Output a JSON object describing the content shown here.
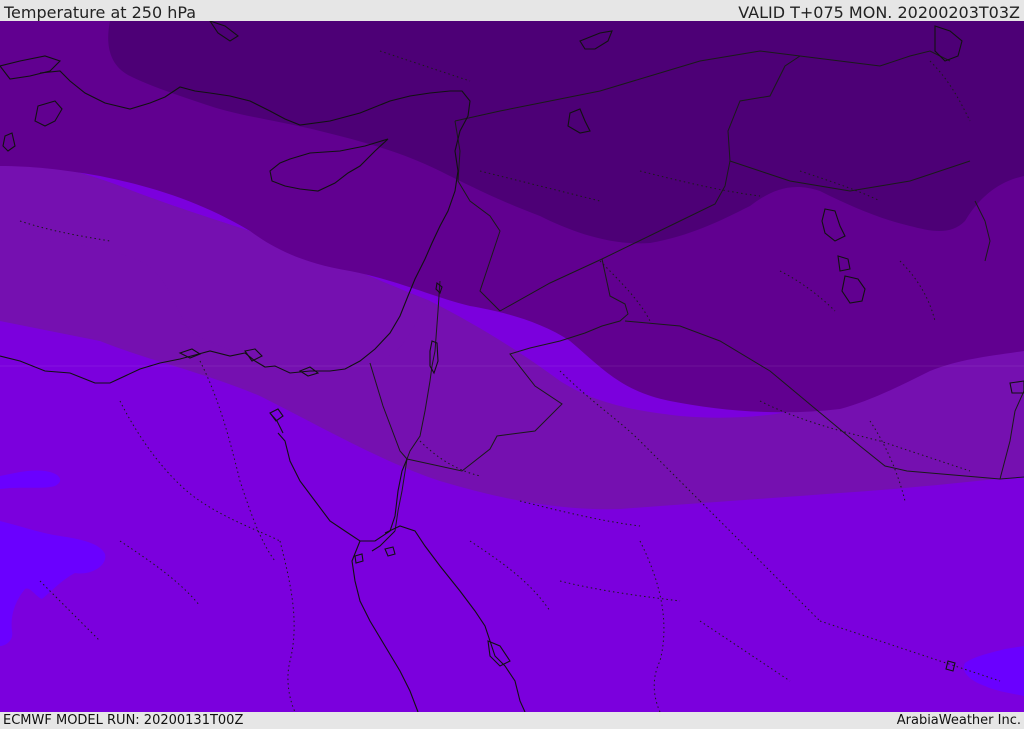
{
  "header": {
    "title": "Temperature at 250 hPa",
    "valid": "VALID T+075 MON. 20200203T03Z"
  },
  "footer": {
    "model_run": "ECMWF MODEL RUN: 20200131T00Z",
    "credit": "ArabiaWeather Inc."
  },
  "map": {
    "field": "temperature",
    "level": "250 hPa",
    "colors": {
      "band_darkest": "#4d0076",
      "band_dark": "#610090",
      "band_mid": "#7510b0",
      "band_base": "#7b00dd",
      "band_warm": "#6a00ff",
      "coast": "#111111",
      "border": "#1a1a1a"
    }
  }
}
